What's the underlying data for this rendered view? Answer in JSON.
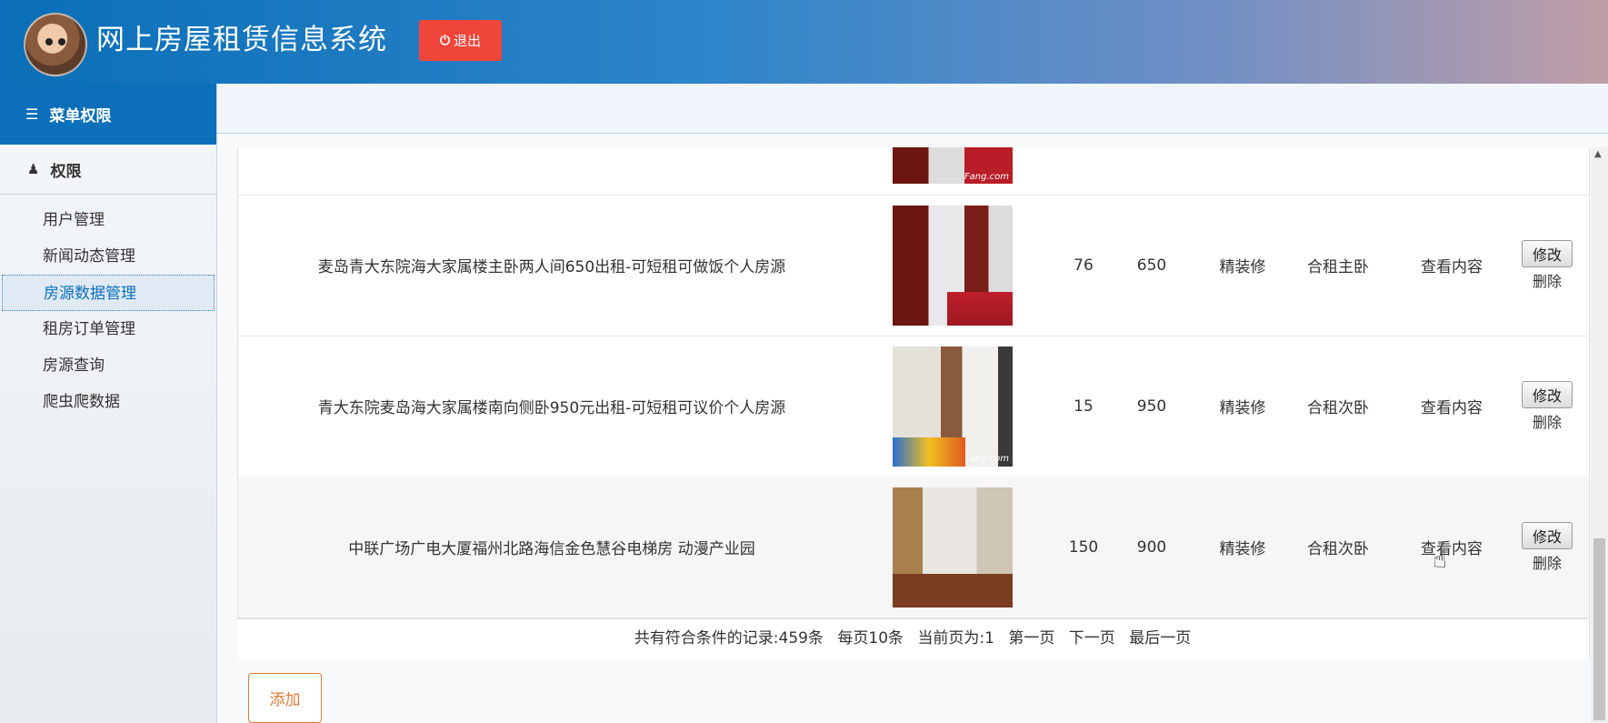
{
  "header": {
    "app_title": "网上房屋租赁信息系统",
    "logout_label": "退出",
    "brand_color": "#0b6fb9",
    "logout_color": "#f0453a"
  },
  "sidebar": {
    "menu_title": "菜单权限",
    "section_title": "权限",
    "items": [
      {
        "label": "用户管理",
        "active": false
      },
      {
        "label": "新闻动态管理",
        "active": false
      },
      {
        "label": "房源数据管理",
        "active": true
      },
      {
        "label": "租房订单管理",
        "active": false
      },
      {
        "label": "房源查询",
        "active": false
      },
      {
        "label": "爬虫爬数据",
        "active": false
      }
    ]
  },
  "table": {
    "rows": [
      {
        "title": "麦岛青大东院海大家属楼主卧两人间650出租-可短租可做饭个人房源",
        "image": "bedroom-photo",
        "area": "76",
        "price": "650",
        "decoration": "精装修",
        "rent_type": "合租主卧",
        "view": "查看内容",
        "edit": "修改",
        "delete": "删除"
      },
      {
        "title": "青大东院麦岛海大家属楼南向侧卧950元出租-可短租可议价个人房源",
        "image": "bedroom-photo",
        "area": "15",
        "price": "950",
        "decoration": "精装修",
        "rent_type": "合租次卧",
        "view": "查看内容",
        "edit": "修改",
        "delete": "删除"
      },
      {
        "title": "中联广场广电大厦福州北路海信金色慧谷电梯房 动漫产业园",
        "image": "bedroom-photo",
        "area": "150",
        "price": "900",
        "decoration": "精装修",
        "rent_type": "合租次卧",
        "view": "查看内容",
        "edit": "修改",
        "delete": "删除"
      }
    ],
    "image_watermark": "Fang.com"
  },
  "pager": {
    "total": "共有符合条件的记录:459条",
    "per_page": "每页10条",
    "current": "当前页为:1",
    "first": "第一页",
    "next": "下一页",
    "last": "最后一页"
  },
  "actions": {
    "add_label": "添加"
  }
}
